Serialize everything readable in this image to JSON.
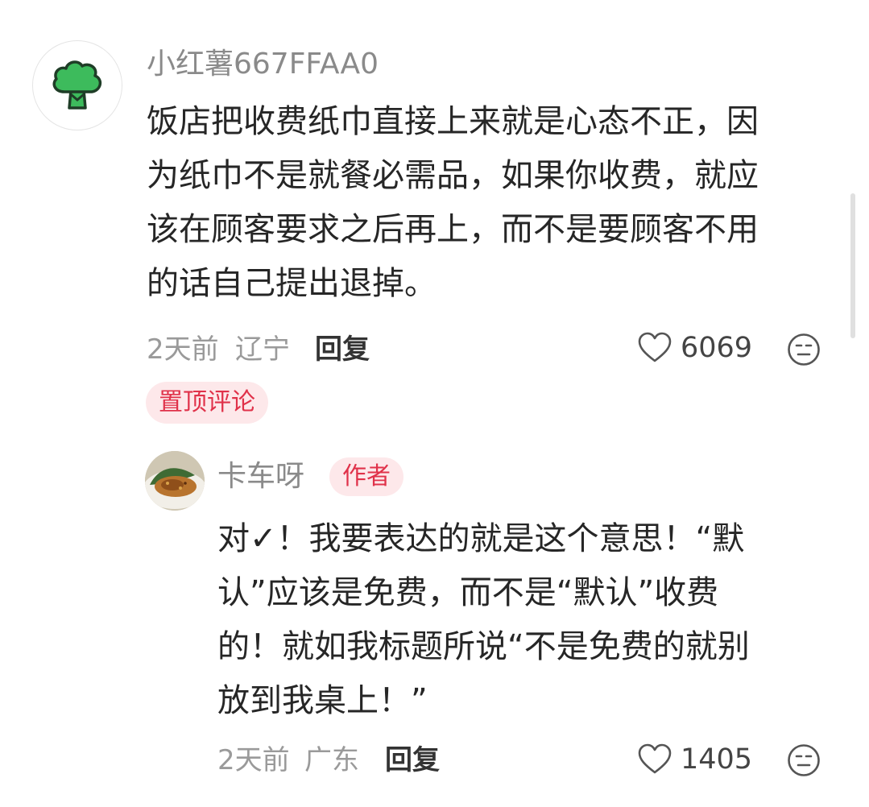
{
  "comment": {
    "username": "小红薯667FFAA0",
    "content": "饭店把收费纸巾直接上来就是心态不正，因\n为纸巾不是就餐必需品，如果你收费，就应\n该在顾客要求之后再上，而不是要顾客不用\n的话自己提出退掉。",
    "time": "2天前",
    "location": "辽宁",
    "reply_label": "回复",
    "likes": "6069",
    "pinned_label": "置顶评论",
    "avatar_icon": "broccoli-icon"
  },
  "reply": {
    "username": "卡车呀",
    "author_badge": "作者",
    "content": "对✓！我要表达的就是这个意思！“默\n认”应该是免费，而不是“默认”收费\n的！就如我标题所说“不是免费的就别\n放到我桌上！”",
    "time": "2天前",
    "location": "广东",
    "reply_label": "回复",
    "likes": "1405",
    "avatar_icon": "food-photo-avatar"
  },
  "colors": {
    "accent_red": "#e0324a",
    "badge_bg": "#fde8ea",
    "broccoli_green": "#3dbb5c",
    "meta_gray": "#9a9a9a"
  }
}
